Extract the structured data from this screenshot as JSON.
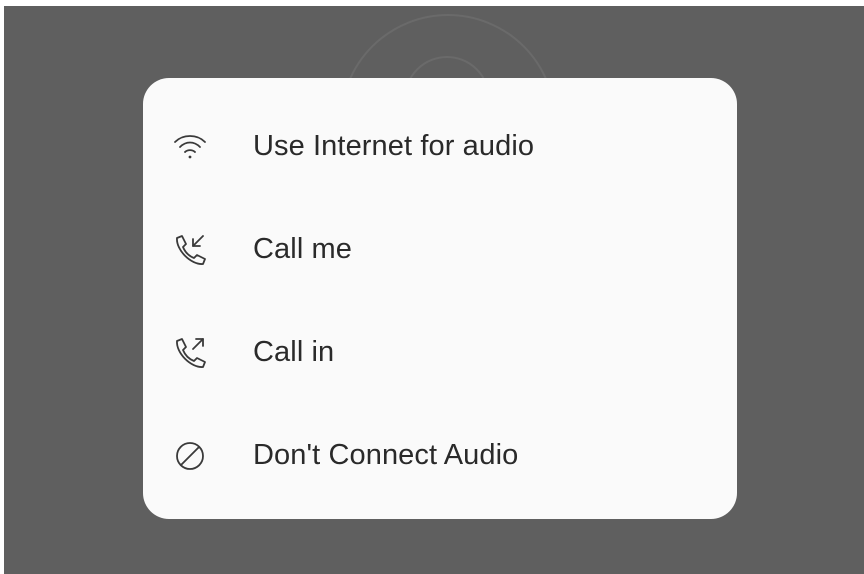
{
  "audio_options": {
    "items": [
      {
        "id": "internet",
        "label": "Use Internet for audio",
        "icon": "wifi-icon"
      },
      {
        "id": "call-me",
        "label": "Call me",
        "icon": "phone-incoming-icon"
      },
      {
        "id": "call-in",
        "label": "Call in",
        "icon": "phone-outgoing-icon"
      },
      {
        "id": "none",
        "label": "Don't Connect Audio",
        "icon": "no-audio-icon"
      }
    ]
  },
  "colors": {
    "backdrop": "#5f5f5f",
    "sheet": "#fafafa",
    "text": "#2a2a2a",
    "icon": "#3a3a3a"
  }
}
